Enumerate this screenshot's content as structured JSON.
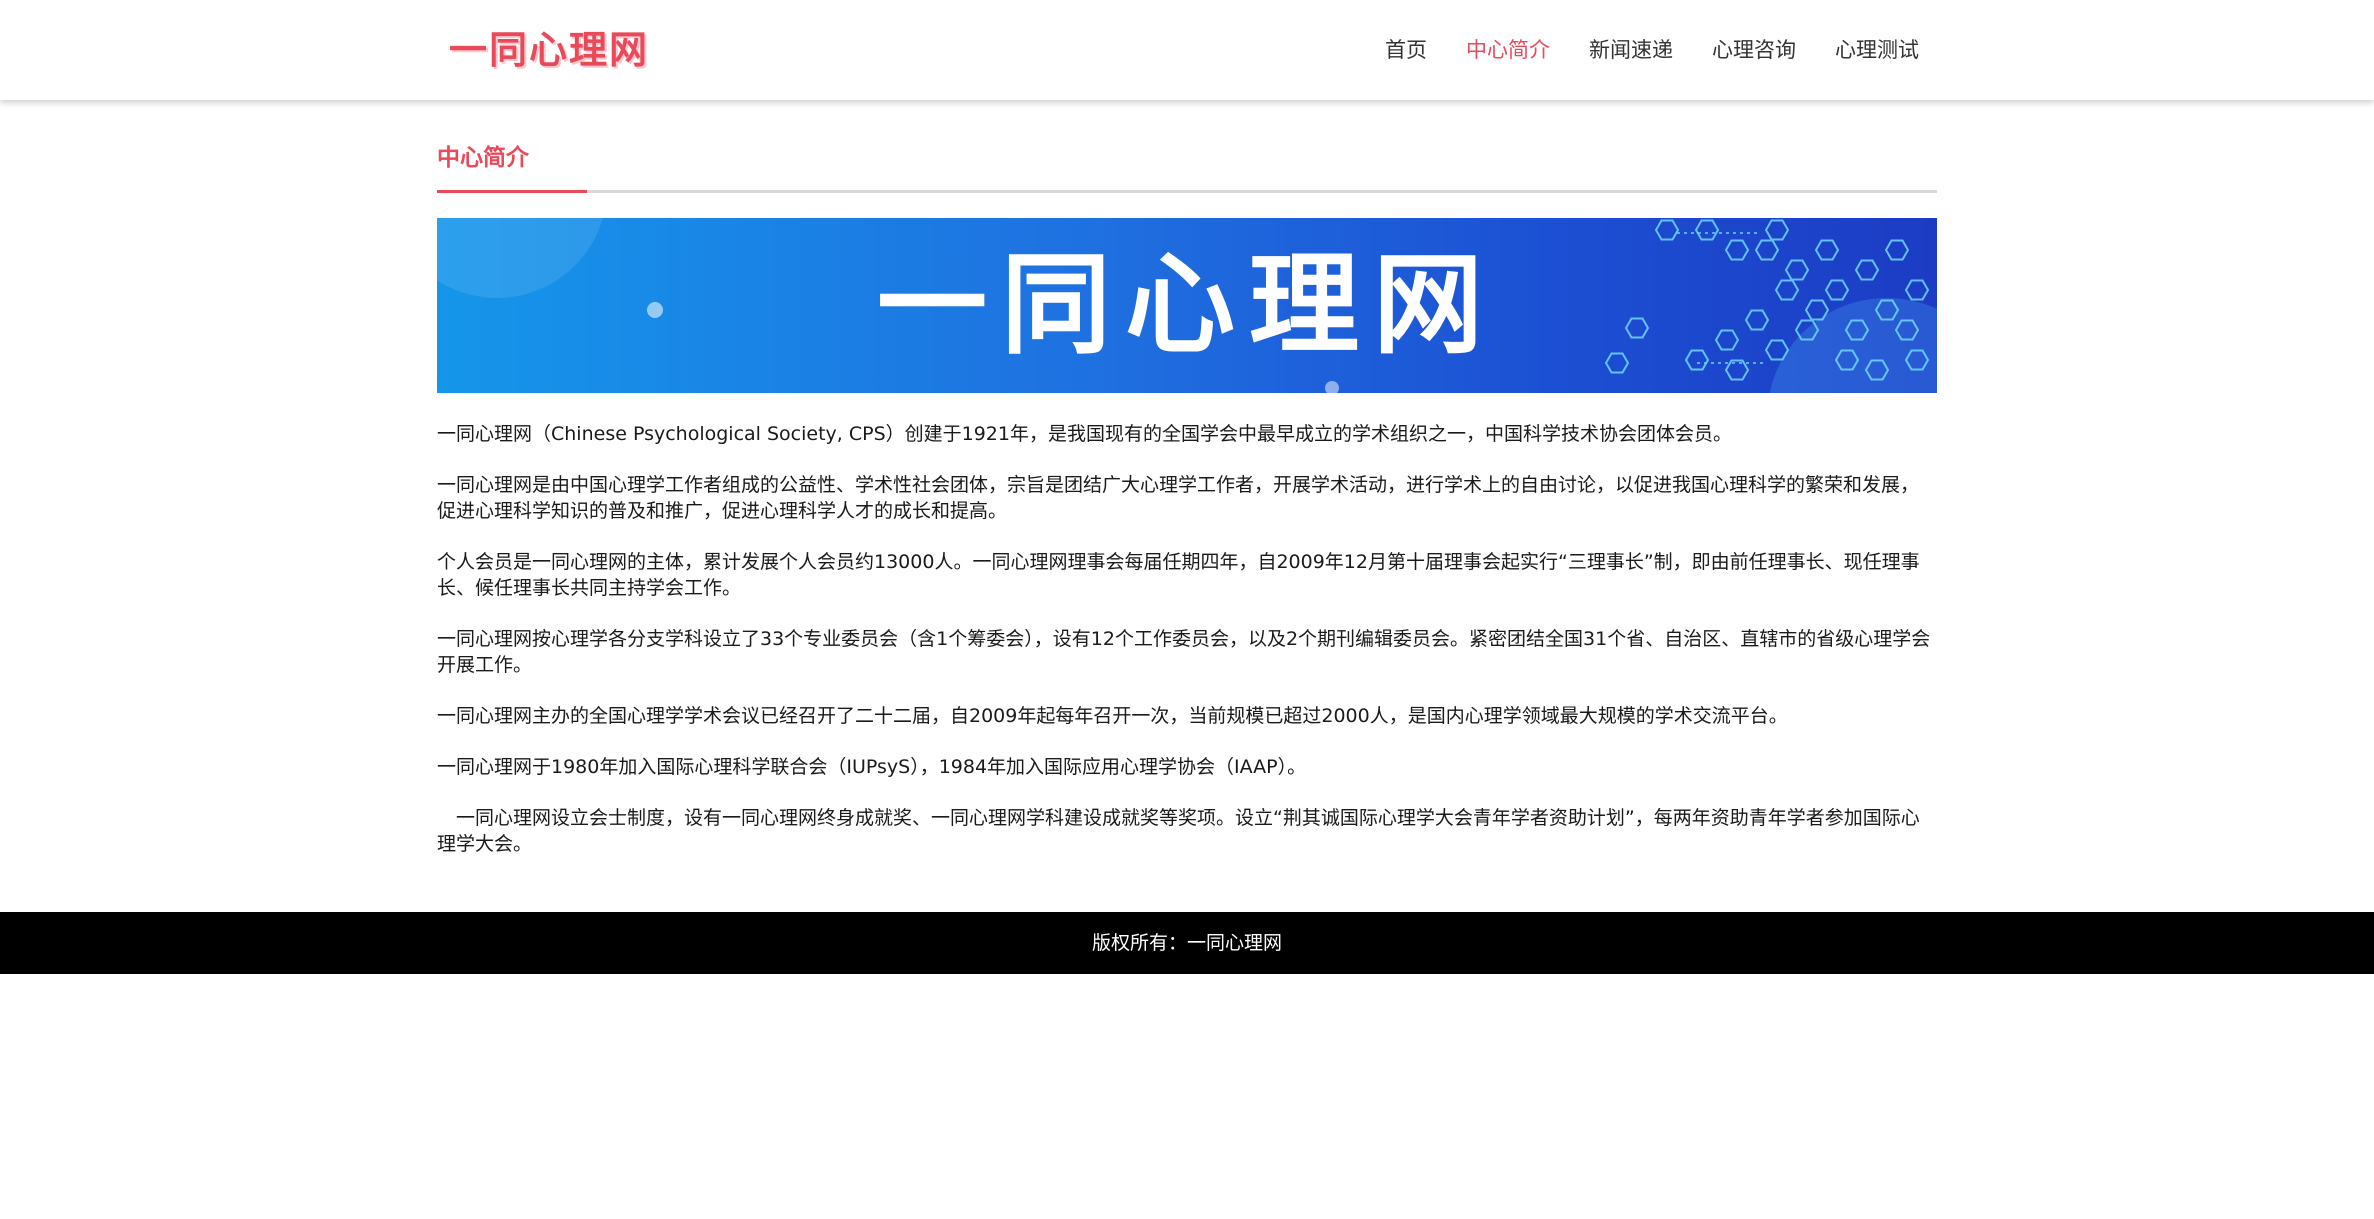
{
  "header": {
    "logo_text": "一同心理网",
    "nav": [
      {
        "label": "首页",
        "active": false
      },
      {
        "label": "中心简介",
        "active": true
      },
      {
        "label": "新闻速递",
        "active": false
      },
      {
        "label": "心理咨询",
        "active": false
      },
      {
        "label": "心理测试",
        "active": false
      }
    ]
  },
  "main": {
    "section_title": "中心简介",
    "banner_text": "一同心理网",
    "paragraphs": [
      "一同心理网（Chinese Psychological Society, CPS）创建于1921年，是我国现有的全国学会中最早成立的学术组织之一，中国科学技术协会团体会员。",
      "一同心理网是由中国心理学工作者组成的公益性、学术性社会团体，宗旨是团结广大心理学工作者，开展学术活动，进行学术上的自由讨论，以促进我国心理科学的繁荣和发展，促进心理科学知识的普及和推广，促进心理科学人才的成长和提高。",
      "个人会员是一同心理网的主体，累计发展个人会员约13000人。一同心理网理事会每届任期四年，自2009年12月第十届理事会起实行“三理事长”制，即由前任理事长、现任理事长、候任理事长共同主持学会工作。",
      "一同心理网按心理学各分支学科设立了33个专业委员会（含1个筹委会），设有12个工作委员会，以及2个期刊编辑委员会。紧密团结全国31个省、自治区、直辖市的省级心理学会开展工作。",
      "一同心理网主办的全国心理学学术会议已经召开了二十二届，自2009年起每年召开一次，当前规模已超过2000人，是国内心理学领域最大规模的学术交流平台。",
      "一同心理网于1980年加入国际心理科学联合会（IUPsyS），1984年加入国际应用心理学协会（IAAP）。",
      "　一同心理网设立会士制度，设有一同心理网终身成就奖、一同心理网学科建设成就奖等奖项。设立“荆其诚国际心理学大会青年学者资助计划”，每两年资助青年学者参加国际心理学大会。"
    ]
  },
  "footer": {
    "copyright": "版权所有：一同心理网"
  },
  "colors": {
    "accent": "#e84a5a",
    "banner_start": "#1596ea",
    "banner_end": "#1c3cc4",
    "footer_bg": "#000000"
  }
}
